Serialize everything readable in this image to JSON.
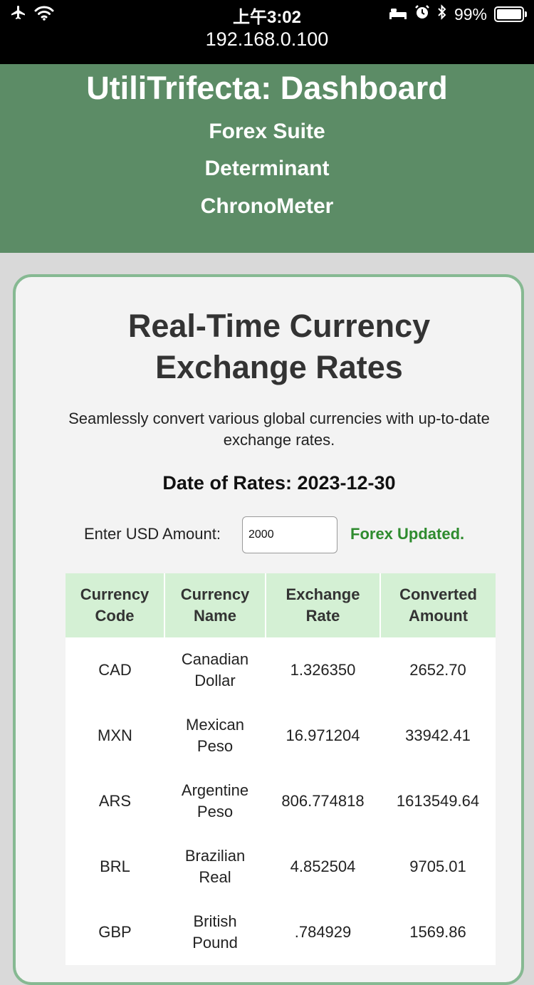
{
  "status_bar": {
    "time": "上午3:02",
    "url": "192.168.0.100",
    "battery_percent": "99%",
    "battery_level": 0.99,
    "icons": [
      "airplane-icon",
      "wifi-icon",
      "bed-icon",
      "alarm-icon",
      "bluetooth-icon",
      "battery-icon"
    ]
  },
  "header": {
    "title": "UtiliTrifecta: Dashboard",
    "nav": [
      "Forex Suite",
      "Determinant",
      "ChronoMeter"
    ]
  },
  "main": {
    "title_line1": "Real-Time Currency",
    "title_line2": "Exchange Rates",
    "description_line1": "Seamlessly convert various global currencies with up-to-date",
    "description_line2": "exchange rates.",
    "date_line": "Date of Rates: 2023-12-30",
    "amount_label": "Enter USD Amount:",
    "amount_value": "2000",
    "status": "Forex Updated.",
    "table": {
      "headers": [
        [
          "Currency",
          "Code"
        ],
        [
          "Currency",
          "Name"
        ],
        [
          "Exchange",
          "Rate"
        ],
        [
          "Converted",
          "Amount"
        ]
      ],
      "rows": [
        {
          "code": "CAD",
          "name1": "Canadian",
          "name2": "Dollar",
          "rate": "1.326350",
          "amount": "2652.70"
        },
        {
          "code": "MXN",
          "name1": "Mexican",
          "name2": "Peso",
          "rate": "16.971204",
          "amount": "33942.41"
        },
        {
          "code": "ARS",
          "name1": "Argentine",
          "name2": "Peso",
          "rate": "806.774818",
          "amount": "1613549.64"
        },
        {
          "code": "BRL",
          "name1": "Brazilian",
          "name2": "Real",
          "rate": "4.852504",
          "amount": "9705.01"
        },
        {
          "code": "GBP",
          "name1": "British",
          "name2": "Pound",
          "rate": ".784929",
          "amount": "1569.86"
        }
      ]
    }
  },
  "colors": {
    "header_bg": "#5c8c66",
    "card_border": "#86b992",
    "table_header_bg": "#d4f0d4",
    "status_green": "#2e8b2e"
  }
}
